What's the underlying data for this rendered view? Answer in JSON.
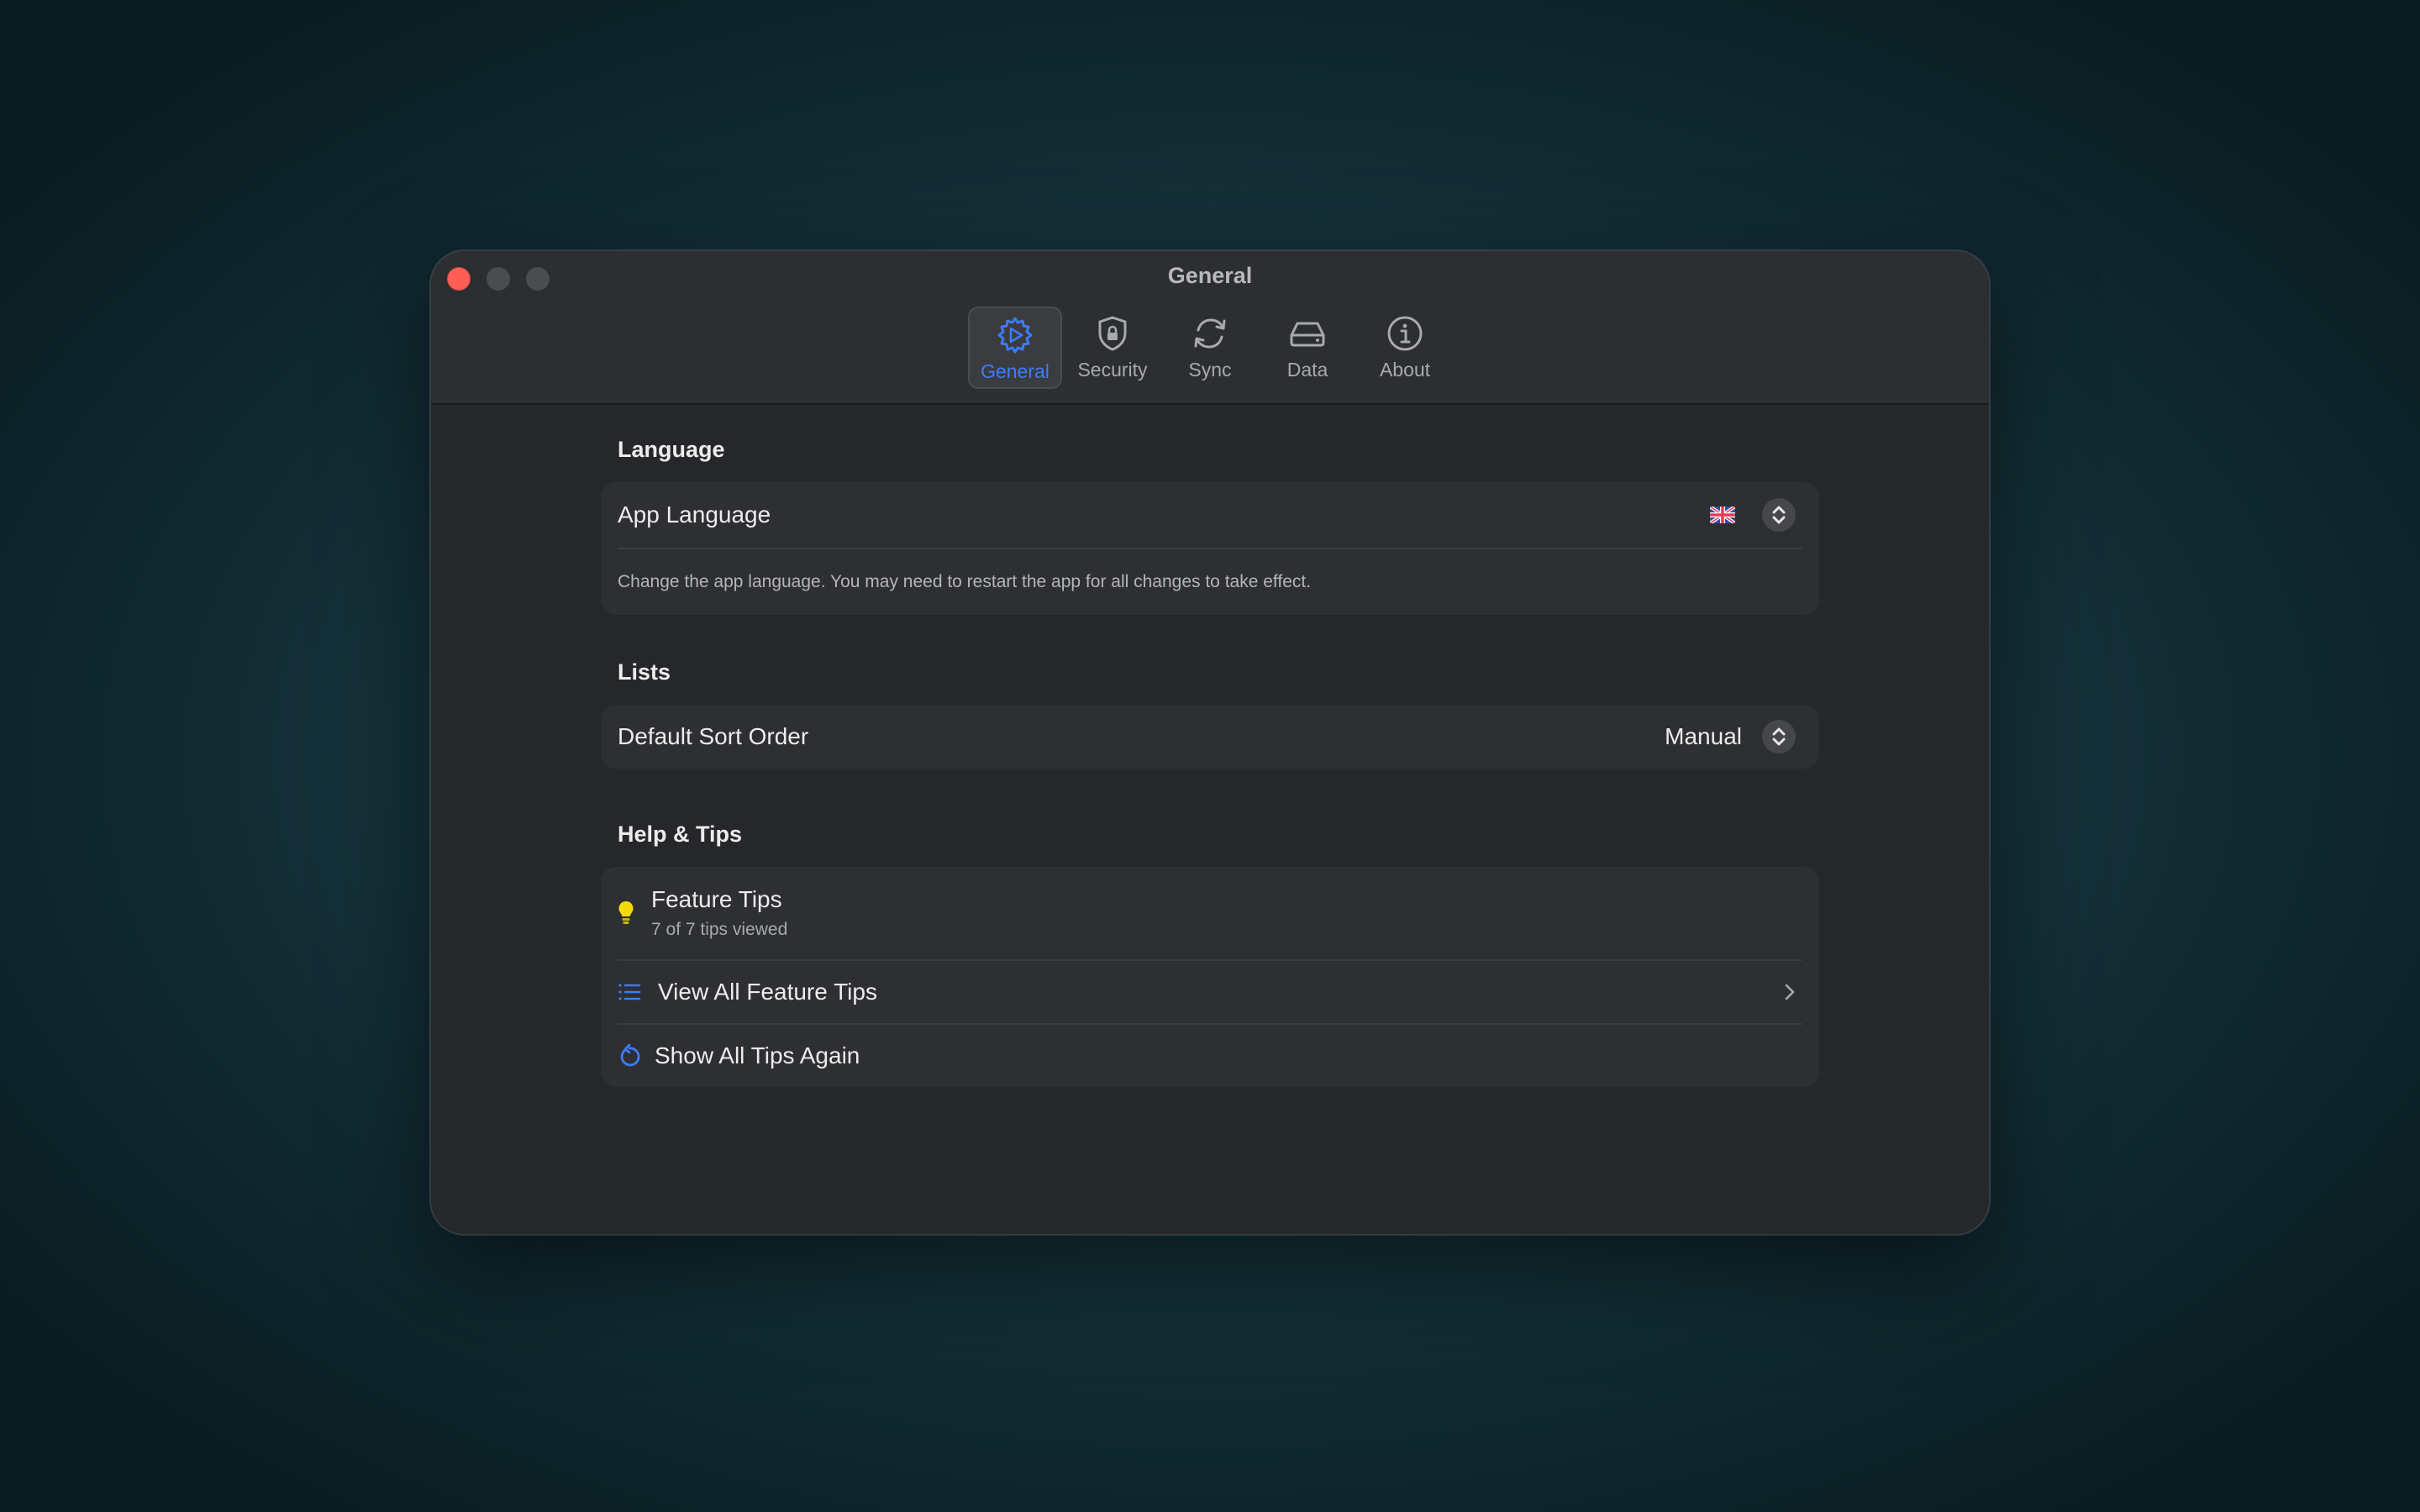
{
  "window": {
    "title": "General"
  },
  "toolbar": {
    "items": [
      {
        "label": "General",
        "icon": "gear-icon",
        "active": true
      },
      {
        "label": "Security",
        "icon": "lock-shield-icon"
      },
      {
        "label": "Sync",
        "icon": "sync-icon"
      },
      {
        "label": "Data",
        "icon": "drive-icon"
      },
      {
        "label": "About",
        "icon": "info-icon"
      }
    ]
  },
  "language": {
    "heading": "Language",
    "app_language_label": "App Language",
    "selected_flag": "uk-flag-icon",
    "description": "Change the app language. You may need to restart the app for all changes to take effect."
  },
  "lists": {
    "heading": "Lists",
    "sort_label": "Default Sort Order",
    "sort_value": "Manual"
  },
  "help": {
    "heading": "Help & Tips",
    "feature_tips_title": "Feature Tips",
    "feature_tips_subtitle": "7 of 7 tips viewed",
    "view_all_label": "View All Feature Tips",
    "show_again_label": "Show All Tips Again"
  },
  "colors": {
    "accent": "#3d7bf7",
    "close": "#ff5f57",
    "bulb": "#f5d90a"
  }
}
